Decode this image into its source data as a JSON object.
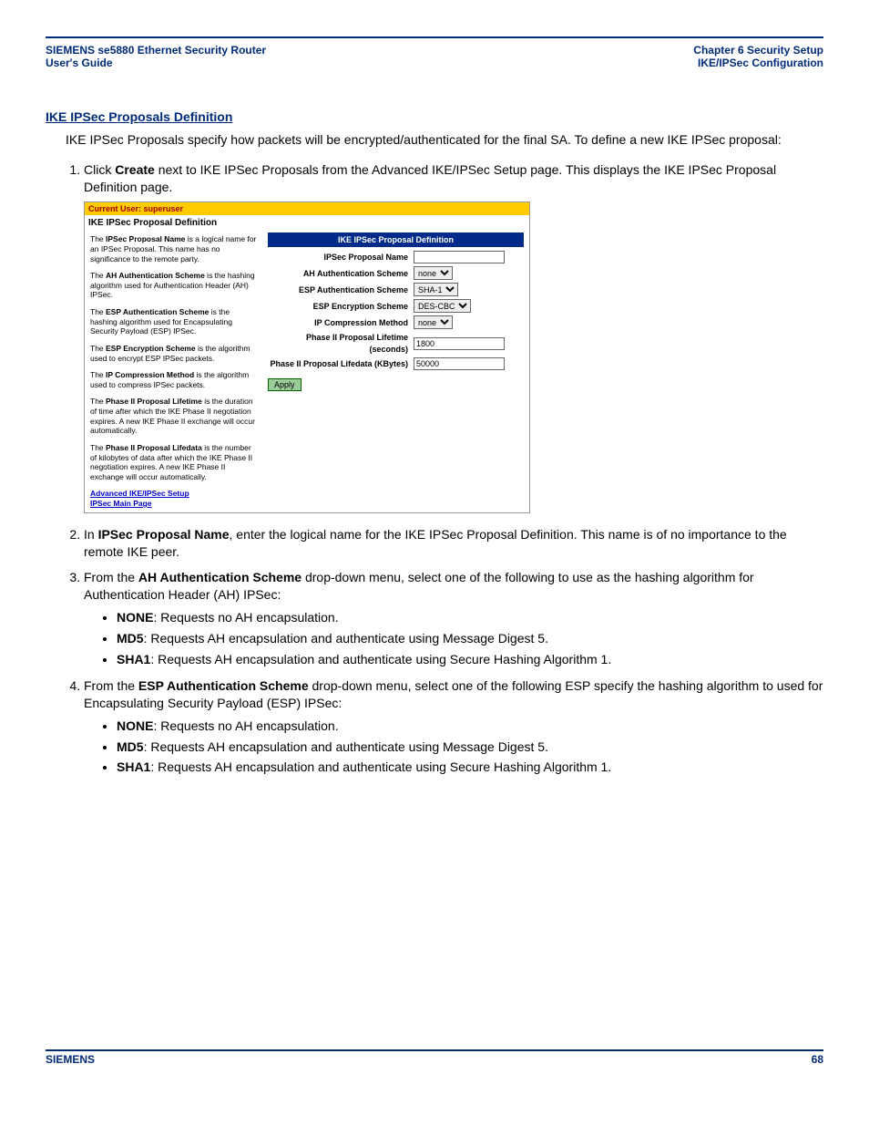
{
  "header": {
    "left_line1": "SIEMENS se5880 Ethernet Security Router",
    "left_line2": "User's Guide",
    "right_line1": "Chapter 6  Security Setup",
    "right_line2": "IKE/IPSec Configuration"
  },
  "section_title": "IKE IPSec Proposals Definition",
  "intro": "IKE IPSec Proposals specify how packets will be encrypted/authenticated for the final SA. To define a new IKE IPSec proposal:",
  "steps": {
    "s1_pre": "Click ",
    "s1_bold": "Create",
    "s1_post": " next to IKE IPSec Proposals from the Advanced IKE/IPSec Setup page. This displays the IKE IPSec Proposal Definition page.",
    "s2_pre": "In ",
    "s2_bold": "IPSec Proposal Name",
    "s2_post": ", enter the logical name for the IKE IPSec Proposal Definition. This name is of no importance to the remote IKE peer.",
    "s3_pre": "From the ",
    "s3_bold": "AH Authentication Scheme",
    "s3_post": " drop-down menu, select one of the following to use as the hashing algorithm for Authentication Header (AH) IPSec:",
    "s4_pre": "From the ",
    "s4_bold": "ESP Authentication Scheme",
    "s4_post": " drop-down menu, select one of the following ESP specify the hashing algorithm to used for Encapsulating Security Payload (ESP) IPSec:"
  },
  "bullets3": {
    "b1_bold": "NONE",
    "b1_text": ": Requests no AH encapsulation.",
    "b2_bold": "MD5",
    "b2_text": ": Requests AH encapsulation and authenticate using Message Digest 5.",
    "b3_bold": "SHA1",
    "b3_text": ": Requests AH encapsulation and authenticate using Secure Hashing Algorithm 1."
  },
  "bullets4": {
    "b1_bold": "NONE",
    "b1_text": ": Requests no AH encapsulation.",
    "b2_bold": "MD5",
    "b2_text": ": Requests AH encapsulation and authenticate using Message Digest 5.",
    "b3_bold": "SHA1",
    "b3_text": ": Requests AH encapsulation and authenticate using Secure Hashing Algorithm 1."
  },
  "screenshot": {
    "userbar": "Current User: superuser",
    "title": "IKE IPSec Proposal Definition",
    "help": {
      "p1a": "The ",
      "p1b": "IPSec Proposal Name",
      "p1c": " is a logical name for an IPSec Proposal. This name has no significance to the remote party.",
      "p2a": "The ",
      "p2b": "AH Authentication Scheme",
      "p2c": " is the hashing algorithm used for Authentication Header (AH) IPSec.",
      "p3a": "The ",
      "p3b": "ESP Authentication Scheme",
      "p3c": " is the hashing algorithm used for Encapsulating Security Payload (ESP) IPSec.",
      "p4a": "The ",
      "p4b": "ESP Encryption Scheme",
      "p4c": " is the algorithm used to encrypt ESP IPSec packets.",
      "p5a": "The ",
      "p5b": "IP Compression Method",
      "p5c": " is the algorithm used to compress IPSec packets.",
      "p6a": "The ",
      "p6b": "Phase II Proposal Lifetime",
      "p6c": " is the duration of time after which the IKE Phase II negotiation expires. A new IKE Phase II exchange will occur automatically.",
      "p7a": "The ",
      "p7b": "Phase II Proposal Lifedata",
      "p7c": " is the number of kilobytes of data after which the IKE Phase II negotiation expires. A new IKE Phase II exchange will occur automatically.",
      "link1": "Advanced IKE/IPSec Setup",
      "link2": "IPSec Main Page"
    },
    "form": {
      "hdr": "IKE IPSec Proposal Definition",
      "r1_lbl": "IPSec Proposal Name",
      "r1_val": "",
      "r2_lbl": "AH Authentication Scheme",
      "r2_val": "none",
      "r3_lbl": "ESP Authentication Scheme",
      "r3_val": "SHA-1",
      "r4_lbl": "ESP Encryption Scheme",
      "r4_val": "DES-CBC",
      "r5_lbl": "IP Compression Method",
      "r5_val": "none",
      "r6_lbl": "Phase II Proposal Lifetime (seconds)",
      "r6_val": "1800",
      "r7_lbl": "Phase II Proposal Lifedata (KBytes)",
      "r7_val": "50000",
      "apply": "Apply"
    }
  },
  "footer": {
    "left": "SIEMENS",
    "right": "68"
  }
}
